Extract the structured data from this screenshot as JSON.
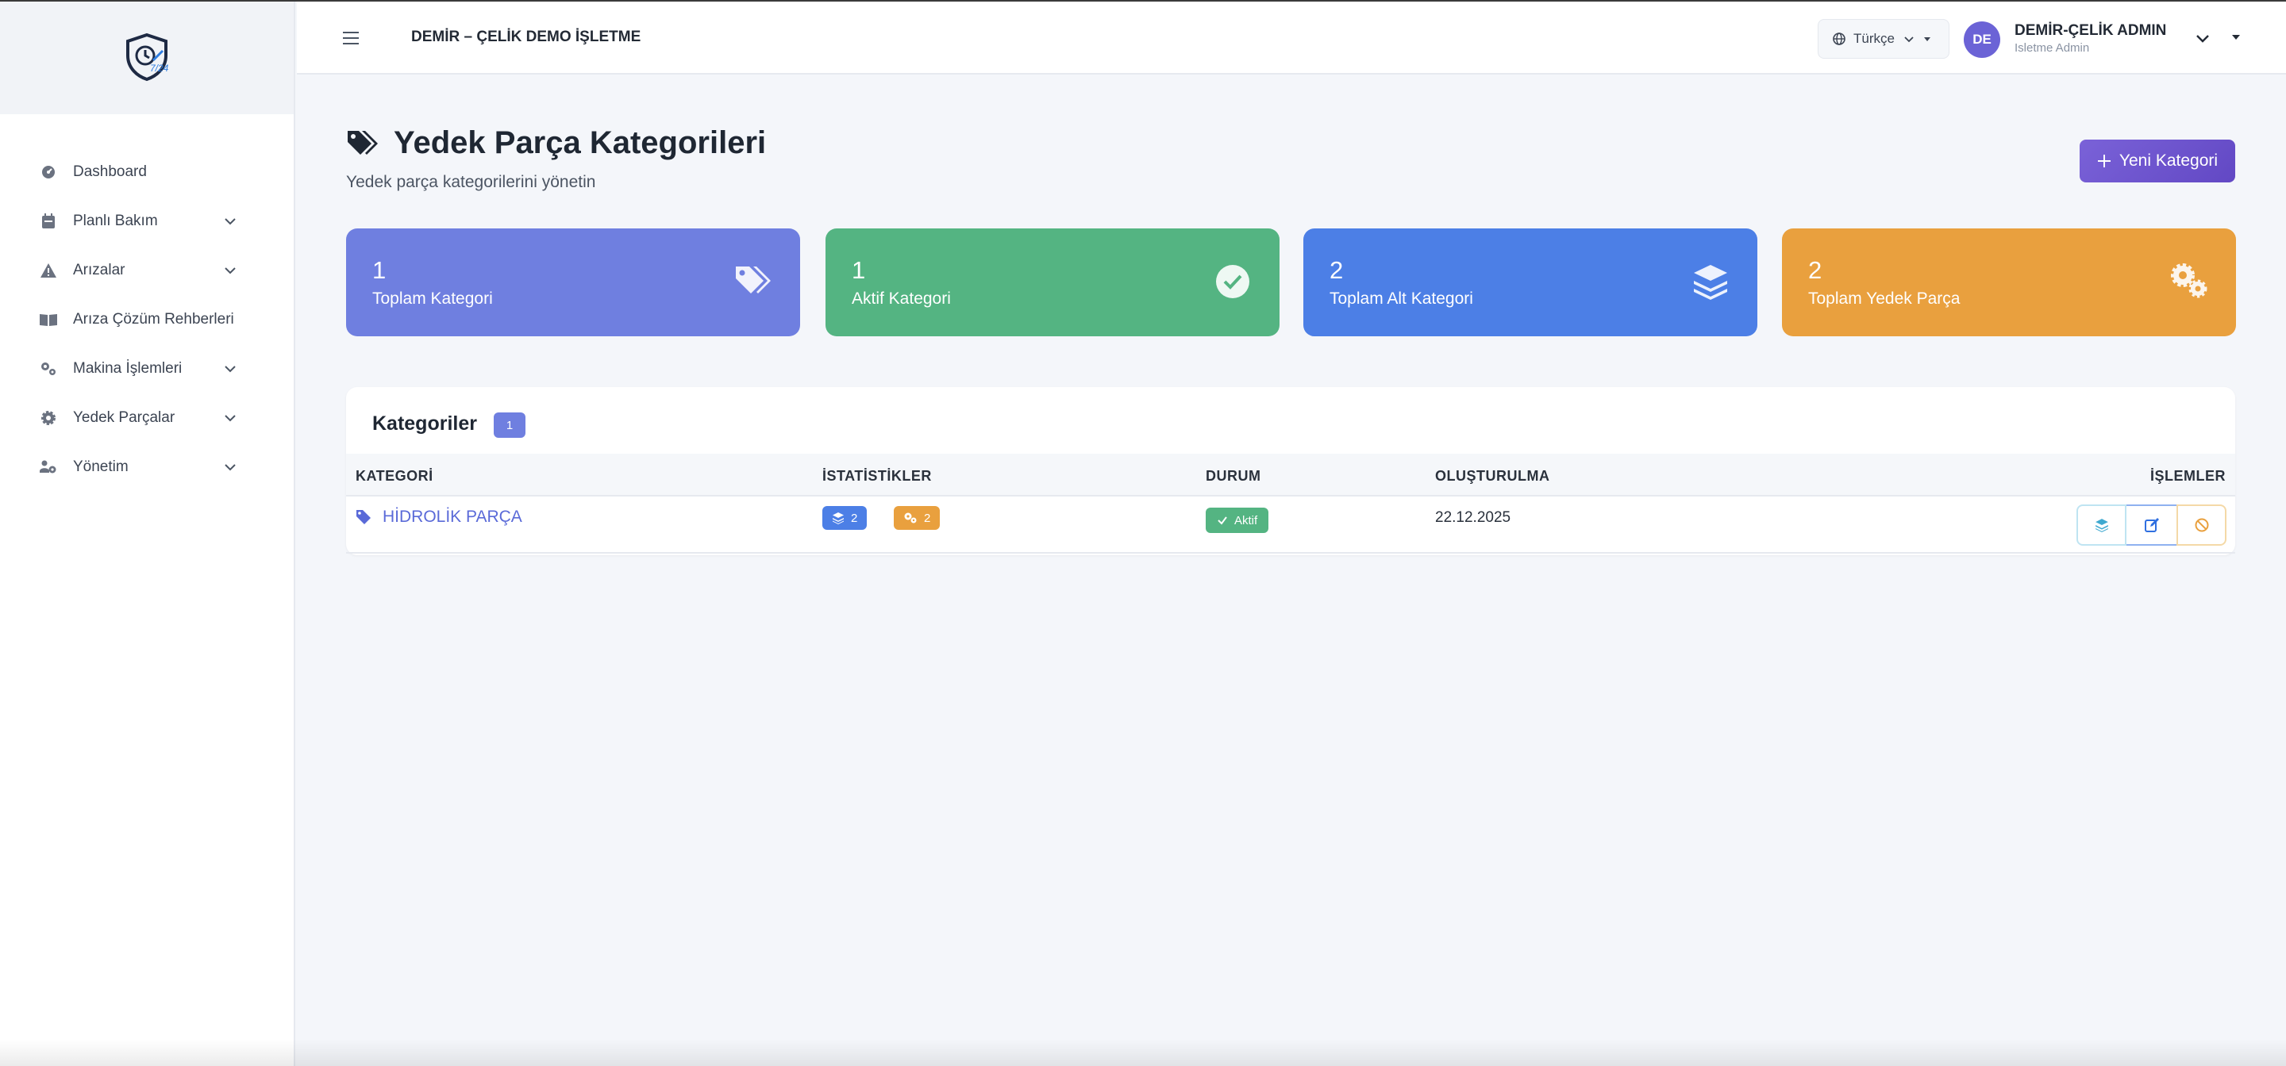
{
  "header": {
    "company": "DEMİR – ÇELİK DEMO İŞLETME",
    "language": "Türkçe",
    "user": {
      "initials": "DE",
      "name": "DEMİR-ÇELİK ADMIN",
      "role": "Isletme Admin"
    }
  },
  "sidebar": {
    "items": [
      {
        "label": "Dashboard",
        "icon": "dashboard-icon",
        "expandable": false
      },
      {
        "label": "Planlı Bakım",
        "icon": "calendar-icon",
        "expandable": true
      },
      {
        "label": "Arızalar",
        "icon": "warning-icon",
        "expandable": true
      },
      {
        "label": "Arıza Çözüm Rehberleri",
        "icon": "book-icon",
        "expandable": false
      },
      {
        "label": "Makina İşlemleri",
        "icon": "gears-icon",
        "expandable": true
      },
      {
        "label": "Yedek Parçalar",
        "icon": "gear-icon",
        "expandable": true
      },
      {
        "label": "Yönetim",
        "icon": "users-cog-icon",
        "expandable": true
      }
    ]
  },
  "page": {
    "title": "Yedek Parça Kategorileri",
    "subtitle": "Yedek parça kategorilerini yönetin",
    "new_button": "Yeni Kategori"
  },
  "stats": [
    {
      "value": "1",
      "label": "Toplam Kategori",
      "icon": "tags-icon",
      "color": "#6f7fe0"
    },
    {
      "value": "1",
      "label": "Aktif Kategori",
      "icon": "check-circle-icon",
      "color": "#54b482"
    },
    {
      "value": "2",
      "label": "Toplam Alt Kategori",
      "icon": "layers-icon",
      "color": "#4c7fe6"
    },
    {
      "value": "2",
      "label": "Toplam Yedek Parça",
      "icon": "gears-icon",
      "color": "#e9a03e"
    }
  ],
  "table": {
    "title": "Kategoriler",
    "count": "1",
    "headers": {
      "category": "KATEGORİ",
      "stats": "İSTATİSTİKLER",
      "status": "DURUM",
      "created": "OLUŞTURULMA",
      "actions": "İŞLEMLER"
    },
    "rows": [
      {
        "name": "HİDROLİK PARÇA",
        "subcategories": "2",
        "parts": "2",
        "status": "Aktif",
        "created": "22.12.2025"
      }
    ]
  }
}
